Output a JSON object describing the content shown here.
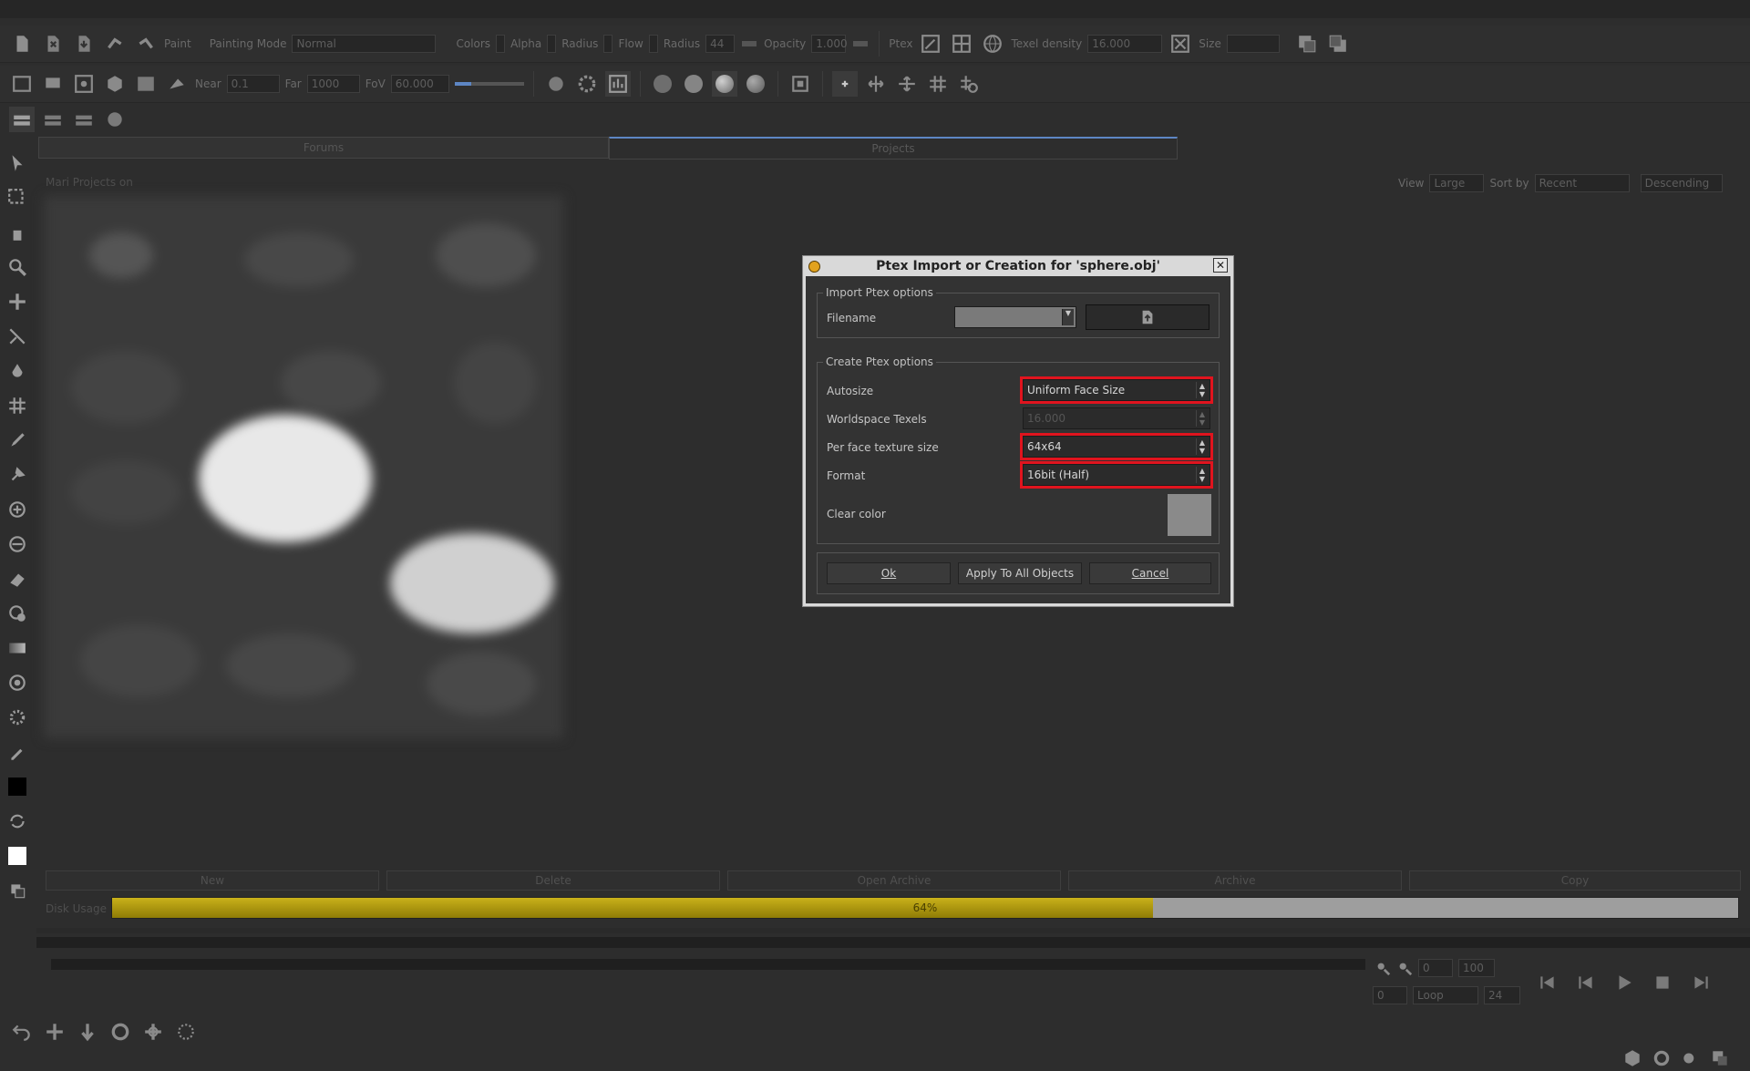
{
  "toolbar1": {
    "paint_label": "Paint",
    "painting_mode_label": "Painting Mode",
    "painting_mode_value": "Normal",
    "colors_label": "Colors",
    "alpha_label": "Alpha",
    "radius_label": "Radius",
    "flow_label": "Flow",
    "radius2_label": "Radius",
    "radius2_value": "44",
    "opacity_label": "Opacity",
    "opacity_value": "1.000",
    "ptex_label": "Ptex",
    "texel_density_label": "Texel density",
    "texel_density_value": "16.000",
    "size_label": "Size"
  },
  "toolbar2": {
    "near_label": "Near",
    "near_value": "0.1",
    "far_label": "Far",
    "far_value": "1000",
    "fov_label": "FoV",
    "fov_value": "60.000"
  },
  "tabs": [
    {
      "label": "Forums"
    },
    {
      "label": "Projects"
    }
  ],
  "projects_panel": {
    "title": "Mari Projects on",
    "view_label": "View",
    "view_value": "Large",
    "sort_label": "Sort by",
    "sort_value": "Recent",
    "order_value": "Descending",
    "buttons": [
      "New",
      "Delete",
      "Open Archive",
      "Archive",
      "Copy"
    ],
    "disk_usage_label": "Disk Usage",
    "disk_usage_percent": 64,
    "disk_usage_text": "64%"
  },
  "timeline": {
    "start": "0",
    "end": "100",
    "frame": "0",
    "loop_value": "Loop",
    "fps": "24"
  },
  "dialog": {
    "title": "Ptex Import or Creation for 'sphere.obj'",
    "import_group": "Import Ptex options",
    "filename_label": "Filename",
    "create_group": "Create Ptex options",
    "autosize_label": "Autosize",
    "autosize_value": "Uniform Face Size",
    "worldspace_label": "Worldspace Texels",
    "worldspace_value": "16.000",
    "face_size_label": "Per face texture size",
    "face_size_value": "64x64",
    "format_label": "Format",
    "format_value": "16bit (Half)",
    "clear_color_label": "Clear color",
    "clear_color": "#8a8a8a",
    "ok_label": "Ok",
    "apply_all_label": "Apply To All Objects",
    "cancel_label": "Cancel"
  },
  "colors": {
    "highlight": "#e0141e",
    "disk_fill": "#c9b11a",
    "tab_accent": "#5d86c4"
  }
}
